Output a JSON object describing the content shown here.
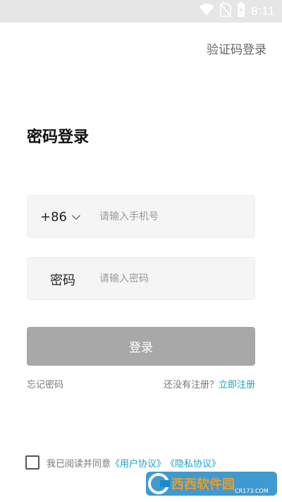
{
  "status_bar": {
    "time": "8:11",
    "icons": [
      "wifi-icon",
      "no-sim-icon",
      "battery-charging-icon"
    ]
  },
  "header": {
    "switch_login_label": "验证码登录"
  },
  "page": {
    "title": "密码登录"
  },
  "form": {
    "country_code": "+86",
    "phone_placeholder": "请输入手机号",
    "password_label": "密码",
    "password_placeholder": "请输入密码",
    "login_button": "登录"
  },
  "links": {
    "forgot_password": "忘记密码",
    "no_account_text": "还没有注册？",
    "register_now": "立即注册"
  },
  "agreement": {
    "checked": false,
    "prefix": "我已阅读并同意",
    "user_agreement": "《用户协议》",
    "privacy_agreement": "《隐私协议》"
  },
  "watermark": {
    "brand": "西西软件园",
    "domain": "CR173.COM"
  },
  "colors": {
    "status_bar_bg": "#e6e6e6",
    "accent": "#1aa3c8",
    "button_disabled": "#a8a8a8",
    "field_bg": "#f5f5f5"
  }
}
